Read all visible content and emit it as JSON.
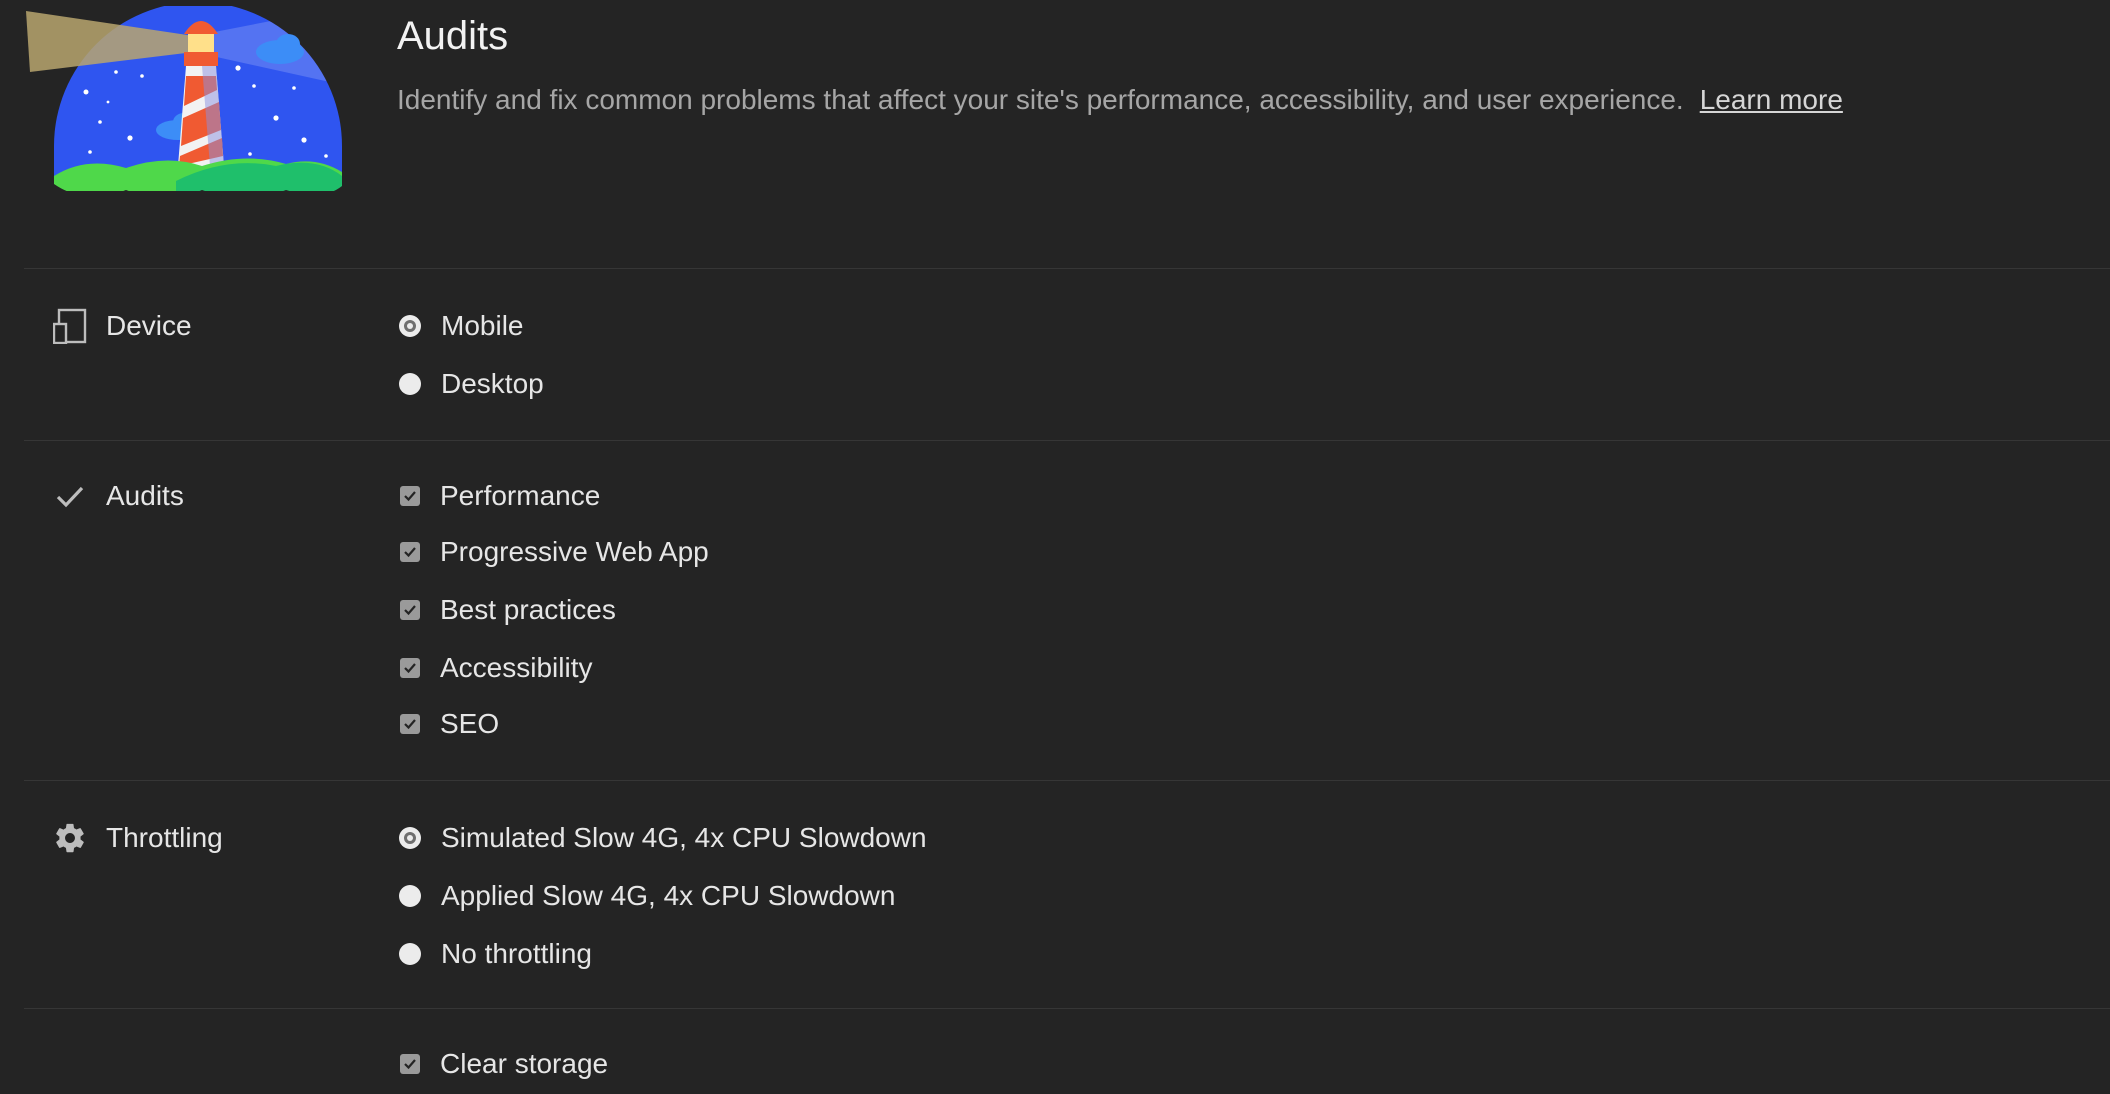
{
  "header": {
    "title": "Audits",
    "description": "Identify and fix common problems that affect your site's performance, accessibility, and user experience.",
    "learn_more": "Learn more"
  },
  "sections": {
    "device": {
      "label": "Device",
      "icon": "device-icon",
      "options": [
        {
          "label": "Mobile",
          "type": "radio",
          "checked": true
        },
        {
          "label": "Desktop",
          "type": "radio",
          "checked": false
        }
      ]
    },
    "audits": {
      "label": "Audits",
      "icon": "checkmark-icon",
      "options": [
        {
          "label": "Performance",
          "type": "checkbox",
          "checked": true
        },
        {
          "label": "Progressive Web App",
          "type": "checkbox",
          "checked": true
        },
        {
          "label": "Best practices",
          "type": "checkbox",
          "checked": true
        },
        {
          "label": "Accessibility",
          "type": "checkbox",
          "checked": true
        },
        {
          "label": "SEO",
          "type": "checkbox",
          "checked": true
        }
      ]
    },
    "throttling": {
      "label": "Throttling",
      "icon": "gear-icon",
      "options": [
        {
          "label": "Simulated Slow 4G, 4x CPU Slowdown",
          "type": "radio",
          "checked": true
        },
        {
          "label": "Applied Slow 4G, 4x CPU Slowdown",
          "type": "radio",
          "checked": false
        },
        {
          "label": "No throttling",
          "type": "radio",
          "checked": false
        }
      ]
    },
    "storage": {
      "options": [
        {
          "label": "Clear storage",
          "type": "checkbox",
          "checked": true
        }
      ]
    }
  },
  "colors": {
    "background": "#242424",
    "text": "#e3e3e3",
    "muted_text": "#a6a6a6",
    "divider": "#363636",
    "control": "#9a9a9a"
  }
}
